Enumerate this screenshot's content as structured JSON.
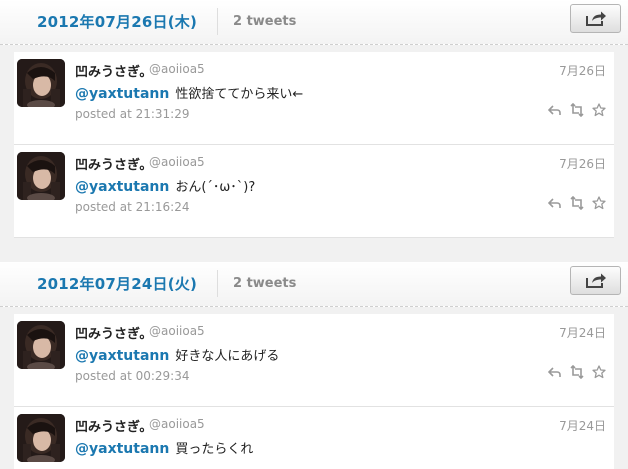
{
  "days": [
    {
      "date": "2012年07月26日(木)",
      "count": "2 tweets",
      "tweets": [
        {
          "name": "凹みうさぎ。",
          "handle": "@aoiioa5",
          "date": "7月26日",
          "mention": "@yaxtutann",
          "text": "性欲捨ててから来い←",
          "posted": "posted at 21:31:29"
        },
        {
          "name": "凹みうさぎ。",
          "handle": "@aoiioa5",
          "date": "7月26日",
          "mention": "@yaxtutann",
          "text": "おん(´･ω･`)?",
          "posted": "posted at 21:16:24"
        }
      ]
    },
    {
      "date": "2012年07月24日(火)",
      "count": "2 tweets",
      "tweets": [
        {
          "name": "凹みうさぎ。",
          "handle": "@aoiioa5",
          "date": "7月24日",
          "mention": "@yaxtutann",
          "text": "好きな人にあげる",
          "posted": "posted at 00:29:34"
        },
        {
          "name": "凹みうさぎ。",
          "handle": "@aoiioa5",
          "date": "7月24日",
          "mention": "@yaxtutann",
          "text": "買ったらくれ",
          "posted": ""
        }
      ]
    }
  ],
  "icons": {
    "share": "share-icon",
    "reply": "reply-icon",
    "retweet": "retweet-icon",
    "favorite": "star-icon"
  },
  "colors": {
    "accent": "#1b78b0",
    "muted": "#999999",
    "background": "#f1f1f1"
  }
}
